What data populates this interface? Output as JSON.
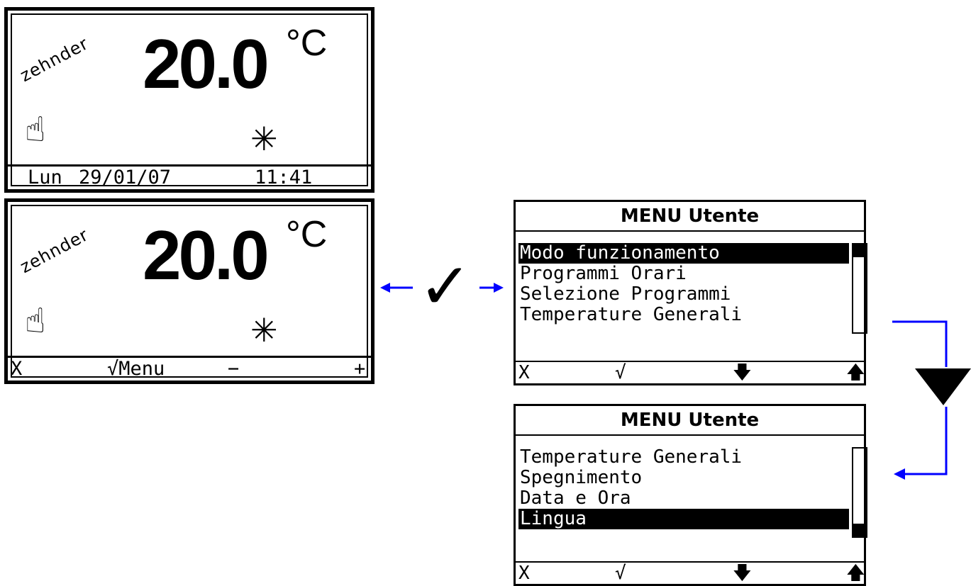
{
  "screen1": {
    "brand": "zehnder",
    "temperature": "20.0",
    "unit": "°C",
    "hand_icon": "hand-pointer-icon",
    "mode_icon": "snowflake-icon",
    "day": "Lun",
    "date": "29/01/07",
    "time": "11:41"
  },
  "screen2": {
    "brand": "zehnder",
    "temperature": "20.0",
    "unit": "°C",
    "softkeys": {
      "cancel": "X",
      "menu": "√Menu",
      "minus": "−",
      "plus": "+"
    }
  },
  "confirm_symbol": "✓",
  "menu1": {
    "title": "MENU Utente",
    "items": [
      "Modo funzionamento",
      "Programmi Orari",
      "Selezione Programmi",
      "Temperature Generali"
    ],
    "selected_index": 0,
    "softkeys": {
      "cancel": "X",
      "ok": "√",
      "down": "🡇",
      "up": "🡅"
    }
  },
  "menu2": {
    "title": "MENU Utente",
    "items": [
      "Temperature Generali",
      "Spegnimento",
      "Data e Ora",
      "Lingua"
    ],
    "selected_index": 3,
    "softkeys": {
      "cancel": "X",
      "ok": "√",
      "down": "🡇",
      "up": "🡅"
    }
  },
  "colors": {
    "arrow": "#0000ff",
    "lcd": "#000000",
    "background": "#ffffff"
  }
}
